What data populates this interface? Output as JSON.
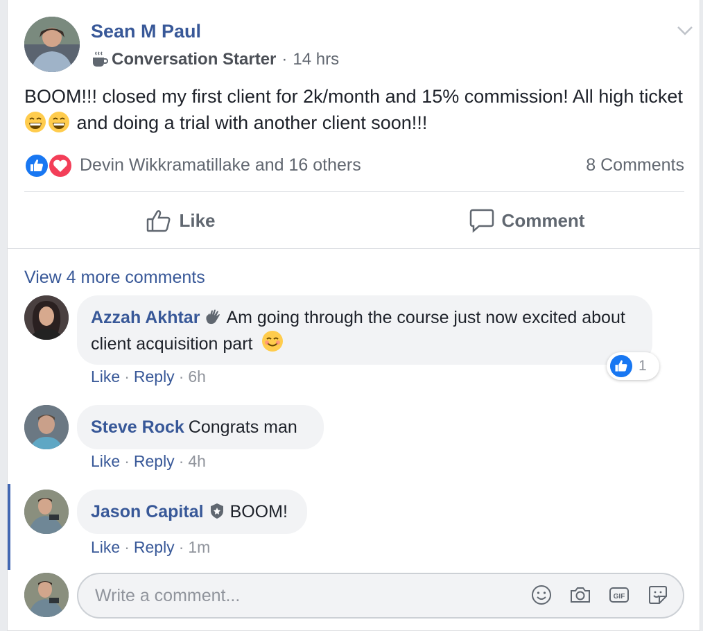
{
  "post": {
    "author": "Sean M Paul",
    "badge_icon": "coffee-cup-icon",
    "badge": "Conversation Starter",
    "dot": "·",
    "time": "14 hrs",
    "text_part1": "BOOM!!! closed my first client for 2k/month and 15% commission! All high ticket ",
    "text_part2": " and doing a trial with another client soon!!!",
    "reactors": "Devin Wikkramatillake and 16 others",
    "comments_count": "8 Comments"
  },
  "actions": {
    "like": "Like",
    "comment": "Comment"
  },
  "view_more": "View 4 more comments",
  "comments": [
    {
      "name": "Azzah Akhtar",
      "badge_icon": "wave-hand-icon",
      "text": "Am going through the course just now excited about client acquisition part",
      "like": "Like",
      "reply": "Reply",
      "time": "6h",
      "reaction_count": "1"
    },
    {
      "name": "Steve Rock",
      "text": "Congrats man",
      "like": "Like",
      "reply": "Reply",
      "time": "4h"
    },
    {
      "name": "Jason Capital",
      "badge_icon": "shield-badge-icon",
      "text": "BOOM!",
      "like": "Like",
      "reply": "Reply",
      "time": "1m"
    }
  ],
  "composer": {
    "placeholder": "Write a comment..."
  },
  "colors": {
    "link": "#385898",
    "like_blue": "#1877f2",
    "love_red": "#f33e58",
    "highlight": "#4267b2"
  }
}
